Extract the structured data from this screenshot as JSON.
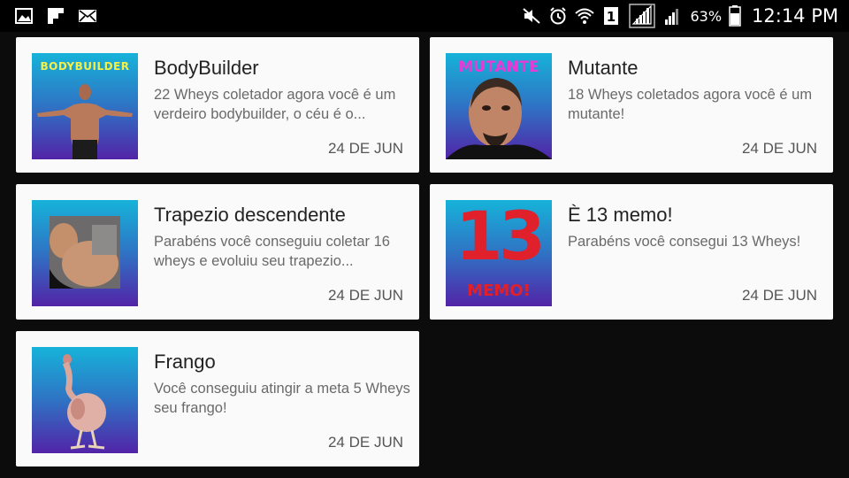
{
  "status_bar": {
    "battery_percent": "63%",
    "time": "12:14 PM",
    "left_icons": [
      "gallery-icon",
      "flipboard-icon",
      "mail-icon"
    ],
    "right_icons": [
      "mute-icon",
      "alarm-icon",
      "wifi-icon",
      "sim1-icon",
      "signal-icon",
      "signal2-icon",
      "battery-icon"
    ]
  },
  "achievements": [
    {
      "title": "BodyBuilder",
      "body": "22 Wheys coletador agora você é um verdeiro bodybuilder, o céu é o...",
      "date": "24 DE JUN",
      "thumb_label": "BODYBUILDER",
      "thumb_label_color": "#f3f04a"
    },
    {
      "title": "Mutante",
      "body": "18 Wheys coletados agora você é um mutante!",
      "date": "24 DE JUN",
      "thumb_label": "MUTANTE",
      "thumb_label_color": "#e83ad7"
    },
    {
      "title": "Trapezio descendente",
      "body": "Parabéns você conseguiu coletar 16 wheys e evoluiu seu trapezio...",
      "date": "24 DE JUN"
    },
    {
      "title": "È 13 memo!",
      "body": "Parabéns você consegui 13 Wheys!",
      "date": "24 DE JUN",
      "thumb_label": "13",
      "thumb_sublabel": "MEMO!",
      "thumb_label_color": "#e0202a"
    },
    {
      "title": "Frango",
      "body": "Você conseguiu atingir a meta 5 Wheys seu frango!",
      "date": "24 DE JUN"
    }
  ],
  "colors": {
    "background": "#0c0c0c",
    "card": "#fafafa",
    "thumb_gradient_top": "#16b3d9",
    "thumb_gradient_bottom": "#5223a7"
  }
}
